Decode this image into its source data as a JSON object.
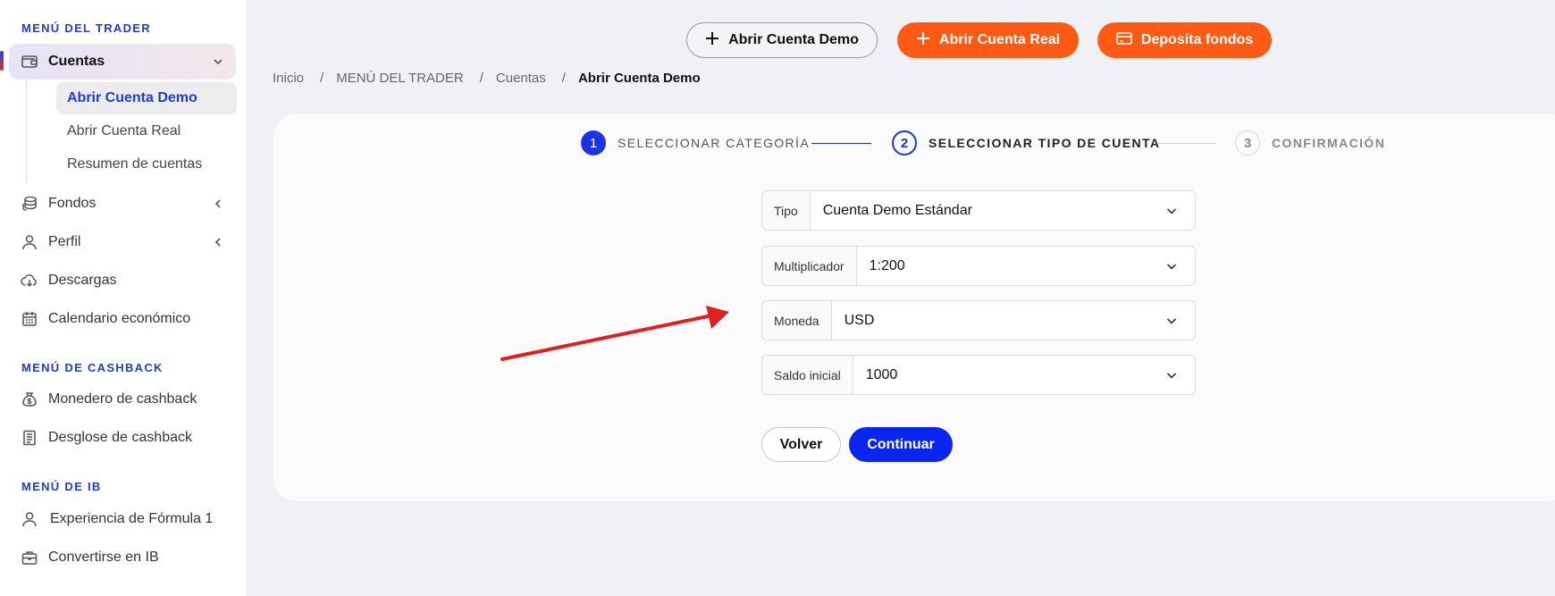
{
  "sidebar": {
    "trader_menu_title": "MENÚ DEL TRADER",
    "cuentas": {
      "label": "Cuentas",
      "icon": "wallet-icon"
    },
    "cuentas_sub": [
      {
        "label": "Abrir Cuenta Demo"
      },
      {
        "label": "Abrir Cuenta Real"
      },
      {
        "label": "Resumen de cuentas"
      }
    ],
    "fondos": {
      "label": "Fondos",
      "icon": "coins-icon"
    },
    "perfil": {
      "label": "Perfil",
      "icon": "user-icon"
    },
    "descargas": {
      "label": "Descargas",
      "icon": "cloud-download-icon"
    },
    "calendario": {
      "label": "Calendario económico",
      "icon": "calendar-icon"
    },
    "cashback_menu_title": "MENÚ DE CASHBACK",
    "monedero": {
      "label": "Monedero de cashback",
      "icon": "money-bag-icon"
    },
    "desglose": {
      "label": "Desglose de cashback",
      "icon": "receipt-icon"
    },
    "ib_menu_title": "MENÚ DE IB",
    "experiencia": {
      "label": "Experiencia de Fórmula 1",
      "icon": "user-icon"
    },
    "convertirse": {
      "label": "Convertirse en IB",
      "icon": "briefcase-icon"
    }
  },
  "topbar": {
    "demo_label": "Abrir Cuenta Demo",
    "real_label": "Abrir Cuenta Real",
    "deposit_label": "Deposita fondos"
  },
  "breadcrumb": {
    "items": [
      "Inicio",
      "MENÚ DEL TRADER",
      "Cuentas"
    ],
    "current": "Abrir Cuenta Demo"
  },
  "stepper": {
    "steps": [
      {
        "num": "1",
        "label": "SELECCIONAR CATEGORÍA"
      },
      {
        "num": "2",
        "label": "SELECCIONAR TIPO DE CUENTA"
      },
      {
        "num": "3",
        "label": "CONFIRMACIÓN"
      }
    ]
  },
  "form": {
    "tipo": {
      "label": "Tipo",
      "value": "Cuenta Demo Estándar"
    },
    "multiplicador": {
      "label": "Multiplicador",
      "value": "1:200"
    },
    "moneda": {
      "label": "Moneda",
      "value": "USD"
    },
    "saldo": {
      "label": "Saldo inicial",
      "value": "1000"
    },
    "back_label": "Volver",
    "continue_label": "Continuar"
  },
  "colors": {
    "accent_blue": "#0a25f0",
    "accent_orange": "#ff5a14",
    "annotation_arrow": "#e02020"
  }
}
